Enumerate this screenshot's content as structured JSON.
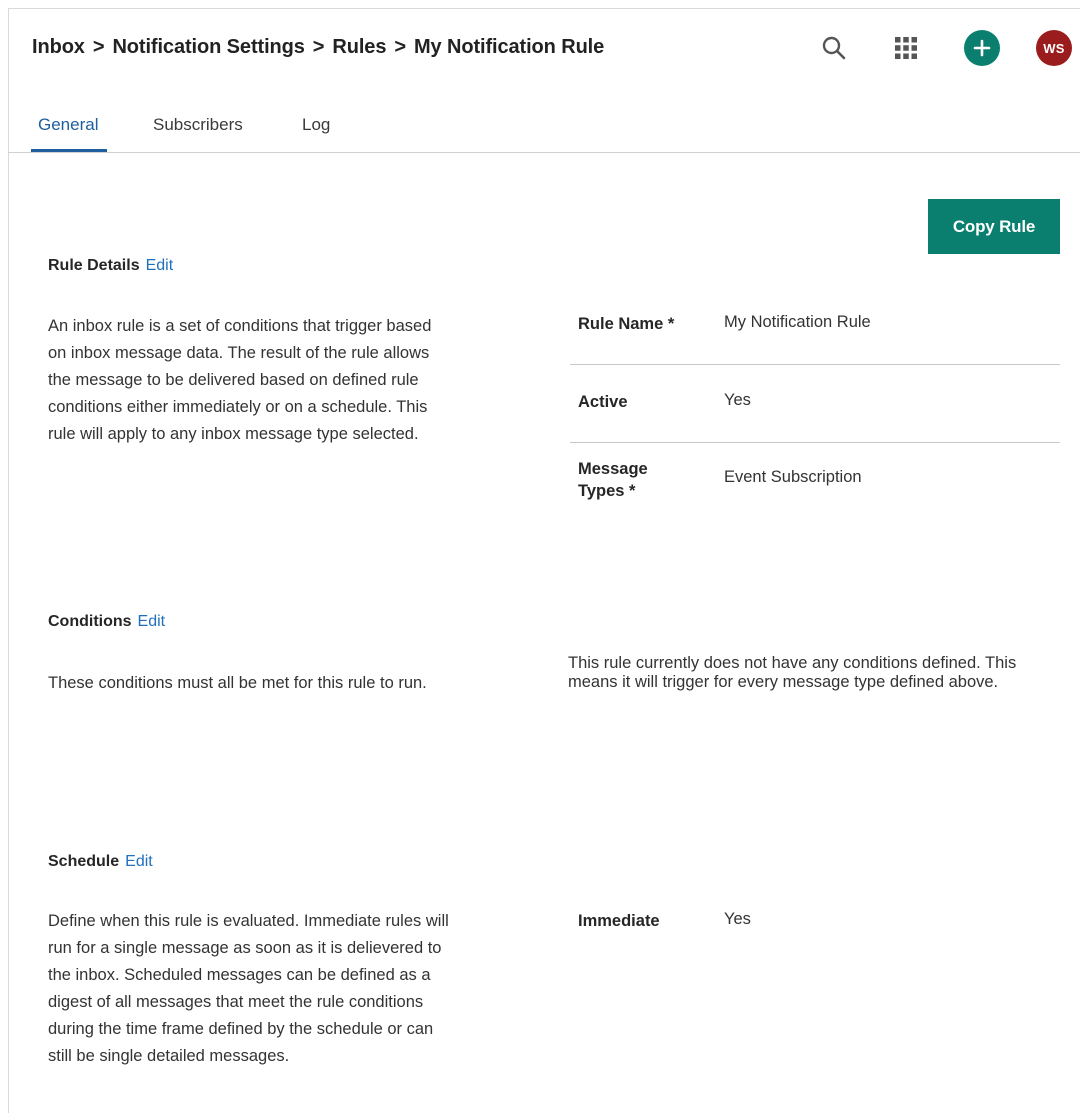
{
  "breadcrumb": {
    "items": [
      "Inbox",
      "Notification Settings",
      "Rules",
      "My Notification Rule"
    ],
    "separator": ">"
  },
  "header": {
    "icons": [
      "search-icon",
      "apps-grid-icon",
      "plus-icon"
    ],
    "avatar_initials": "WS",
    "accent_color": "#0b7f6f",
    "avatar_color": "#9b1c1c"
  },
  "tabs": [
    {
      "label": "General",
      "active": true
    },
    {
      "label": "Subscribers",
      "active": false
    },
    {
      "label": "Log",
      "active": false
    }
  ],
  "copy_button": "Copy Rule",
  "rule_details": {
    "title": "Rule Details",
    "edit": "Edit",
    "description": "An inbox rule is a set of conditions that trigger based on inbox message data. The result of the rule allows the message to be delivered based on defined rule conditions either immediately or on a schedule. This rule will apply to any inbox message type selected.",
    "fields": {
      "rule_name_label": "Rule Name *",
      "rule_name_value": "My Notification Rule",
      "active_label": "Active",
      "active_value": "Yes",
      "message_types_label": "Message Types *",
      "message_types_value": "Event Subscription"
    }
  },
  "conditions": {
    "title": "Conditions",
    "edit": "Edit",
    "description": "These conditions must all be met for this rule to run.",
    "note": "This rule currently does not have any conditions defined. This means it will trigger for every message type defined above."
  },
  "schedule": {
    "title": "Schedule",
    "edit": "Edit",
    "description": "Define when this rule is evaluated. Immediate rules will run for a single message as soon as it is delievered to the inbox. Scheduled messages can be defined as a digest of all messages that meet the rule conditions during the time frame defined by the schedule or can still be single detailed messages.",
    "immediate_label": "Immediate",
    "immediate_value": "Yes"
  }
}
